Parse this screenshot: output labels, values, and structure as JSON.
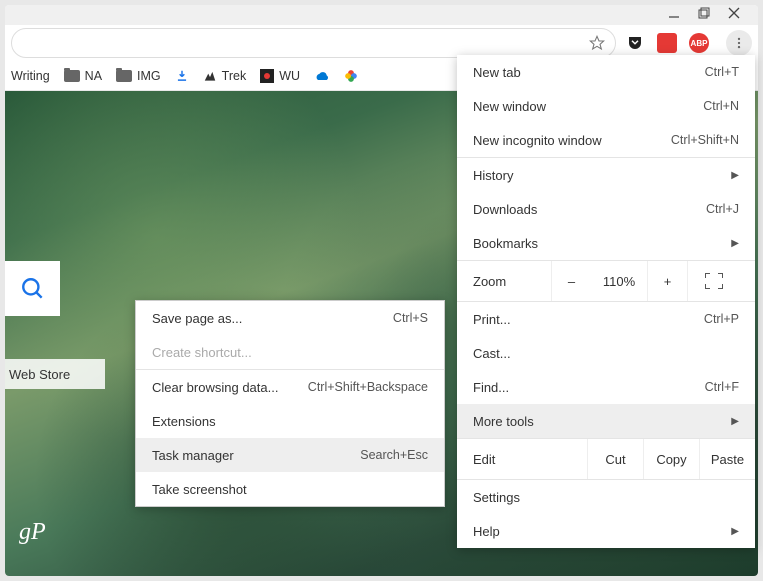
{
  "titlebar": {
    "minimize": "–",
    "maximize": "❐",
    "close": "✕"
  },
  "toolbar": {
    "star_icon": "star",
    "extensions": [
      "pocket",
      "red-square",
      "abp"
    ],
    "menu_icon": "vertical-dots"
  },
  "bookmarks": [
    {
      "label": "Writing",
      "type": "text"
    },
    {
      "label": "NA",
      "type": "folder"
    },
    {
      "label": "IMG",
      "type": "folder"
    },
    {
      "label": "",
      "type": "download"
    },
    {
      "label": "Trek",
      "type": "icon"
    },
    {
      "label": "WU",
      "type": "wu"
    },
    {
      "label": "",
      "type": "onedrive"
    },
    {
      "label": "",
      "type": "photos"
    }
  ],
  "tiles": {
    "webstore": "Web Store"
  },
  "logo": "gP",
  "mainmenu": {
    "new_tab": {
      "label": "New tab",
      "shortcut": "Ctrl+T"
    },
    "new_window": {
      "label": "New window",
      "shortcut": "Ctrl+N"
    },
    "incognito": {
      "label": "New incognito window",
      "shortcut": "Ctrl+Shift+N"
    },
    "history": {
      "label": "History"
    },
    "downloads": {
      "label": "Downloads",
      "shortcut": "Ctrl+J"
    },
    "bookmarks": {
      "label": "Bookmarks"
    },
    "zoom": {
      "label": "Zoom",
      "minus": "–",
      "pct": "110%",
      "plus": "+"
    },
    "print": {
      "label": "Print...",
      "shortcut": "Ctrl+P"
    },
    "cast": {
      "label": "Cast..."
    },
    "find": {
      "label": "Find...",
      "shortcut": "Ctrl+F"
    },
    "more_tools": {
      "label": "More tools"
    },
    "edit": {
      "label": "Edit",
      "cut": "Cut",
      "copy": "Copy",
      "paste": "Paste"
    },
    "settings": {
      "label": "Settings"
    },
    "help": {
      "label": "Help"
    }
  },
  "submenu": {
    "save_as": {
      "label": "Save page as...",
      "shortcut": "Ctrl+S"
    },
    "create_shortcut": {
      "label": "Create shortcut..."
    },
    "clear_data": {
      "label": "Clear browsing data...",
      "shortcut": "Ctrl+Shift+Backspace"
    },
    "extensions": {
      "label": "Extensions"
    },
    "task_manager": {
      "label": "Task manager",
      "shortcut": "Search+Esc"
    },
    "screenshot": {
      "label": "Take screenshot"
    }
  }
}
